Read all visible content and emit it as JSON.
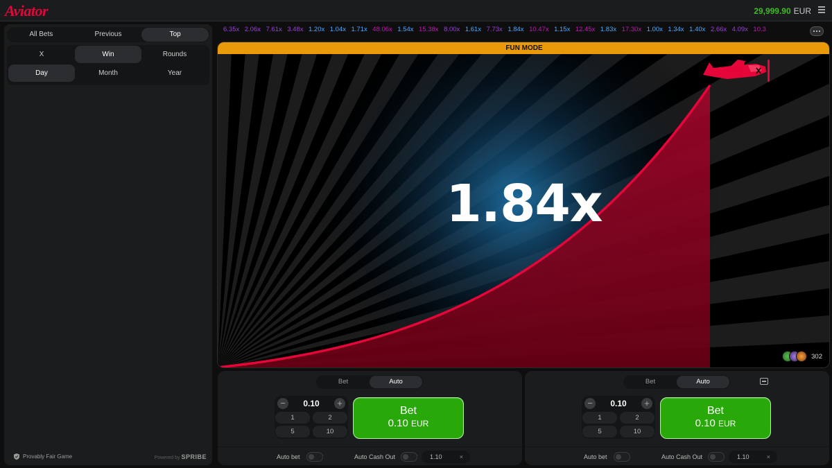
{
  "app": {
    "logo": "Aviator"
  },
  "header": {
    "balance": "29,999.90",
    "currency": "EUR"
  },
  "left_panel": {
    "tabs": [
      "All Bets",
      "Previous",
      "Top"
    ],
    "active_tab": "Top",
    "filter_row1": [
      "X",
      "Win",
      "Rounds"
    ],
    "filter_row2": [
      "Day",
      "Month",
      "Year"
    ],
    "footer_provably": "Provably Fair Game",
    "footer_powered": "Powered by",
    "footer_brand": "SPRIBE"
  },
  "history": [
    {
      "v": "6.35x",
      "c": "#9b3fdb"
    },
    {
      "v": "2.06x",
      "c": "#9b3fdb"
    },
    {
      "v": "7.61x",
      "c": "#9b3fdb"
    },
    {
      "v": "3.48x",
      "c": "#9b3fdb"
    },
    {
      "v": "1.20x",
      "c": "#4aa8ff"
    },
    {
      "v": "1.04x",
      "c": "#4aa8ff"
    },
    {
      "v": "1.71x",
      "c": "#4aa8ff"
    },
    {
      "v": "48.06x",
      "c": "#c017b4"
    },
    {
      "v": "1.54x",
      "c": "#4aa8ff"
    },
    {
      "v": "15.38x",
      "c": "#c017b4"
    },
    {
      "v": "8.00x",
      "c": "#9b3fdb"
    },
    {
      "v": "1.61x",
      "c": "#4aa8ff"
    },
    {
      "v": "7.73x",
      "c": "#9b3fdb"
    },
    {
      "v": "1.84x",
      "c": "#4aa8ff"
    },
    {
      "v": "10.47x",
      "c": "#c017b4"
    },
    {
      "v": "1.15x",
      "c": "#4aa8ff"
    },
    {
      "v": "12.45x",
      "c": "#c017b4"
    },
    {
      "v": "1.83x",
      "c": "#4aa8ff"
    },
    {
      "v": "17.30x",
      "c": "#c017b4"
    },
    {
      "v": "1.00x",
      "c": "#4aa8ff"
    },
    {
      "v": "1.34x",
      "c": "#4aa8ff"
    },
    {
      "v": "1.40x",
      "c": "#4aa8ff"
    },
    {
      "v": "2.66x",
      "c": "#9b3fdb"
    },
    {
      "v": "4.09x",
      "c": "#9b3fdb"
    },
    {
      "v": "10.3",
      "c": "#c017b4"
    }
  ],
  "game": {
    "banner": "FUN MODE",
    "multiplier": "1.84x",
    "online_count": "302",
    "accent": "#e50539"
  },
  "bet_panels": [
    {
      "tabs": [
        "Bet",
        "Auto"
      ],
      "amount": "0.10",
      "quick": [
        "1",
        "2",
        "5",
        "10"
      ],
      "bet_label": "Bet",
      "bet_amount": "0.10",
      "bet_currency": "EUR",
      "auto_bet_label": "Auto bet",
      "auto_cashout_label": "Auto Cash Out",
      "cashout_value": "1.10",
      "clear_symbol": "×"
    },
    {
      "tabs": [
        "Bet",
        "Auto"
      ],
      "amount": "0.10",
      "quick": [
        "1",
        "2",
        "5",
        "10"
      ],
      "bet_label": "Bet",
      "bet_amount": "0.10",
      "bet_currency": "EUR",
      "auto_bet_label": "Auto bet",
      "auto_cashout_label": "Auto Cash Out",
      "cashout_value": "1.10",
      "clear_symbol": "×"
    }
  ],
  "colors": {
    "bet_green": "#28a909",
    "brand_red": "#e50539",
    "fun_mode": "#e99a0a",
    "balance_green": "#3fbb26"
  }
}
